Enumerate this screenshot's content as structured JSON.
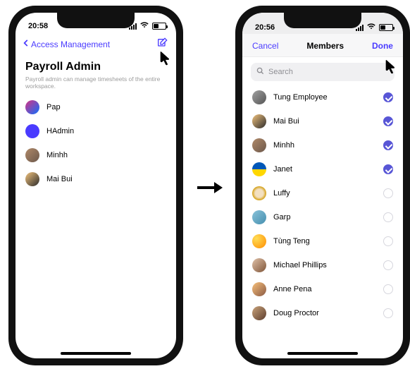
{
  "colors": {
    "accent": "#4a3bff",
    "check": "#5856d6"
  },
  "left": {
    "status_time": "20:58",
    "back_label": "Access Management",
    "title": "Payroll Admin",
    "desc": "Payroll admin can manage timesheets of the entire workspace.",
    "members": [
      {
        "name": "Pap"
      },
      {
        "name": "HAdmin"
      },
      {
        "name": "Minhh"
      },
      {
        "name": "Mai Bui"
      }
    ]
  },
  "right": {
    "status_time": "20:56",
    "cancel": "Cancel",
    "header_title": "Members",
    "done": "Done",
    "search_placeholder": "Search",
    "members": [
      {
        "name": "Tung Employee",
        "selected": true
      },
      {
        "name": "Mai Bui",
        "selected": true
      },
      {
        "name": "Minhh",
        "selected": true
      },
      {
        "name": "Janet",
        "selected": true
      },
      {
        "name": "Luffy",
        "selected": false
      },
      {
        "name": "Garp",
        "selected": false
      },
      {
        "name": "Tùng Teng",
        "selected": false
      },
      {
        "name": "Michael Phillips",
        "selected": false
      },
      {
        "name": "Anne Pena",
        "selected": false
      },
      {
        "name": "Doug Proctor",
        "selected": false
      }
    ]
  }
}
